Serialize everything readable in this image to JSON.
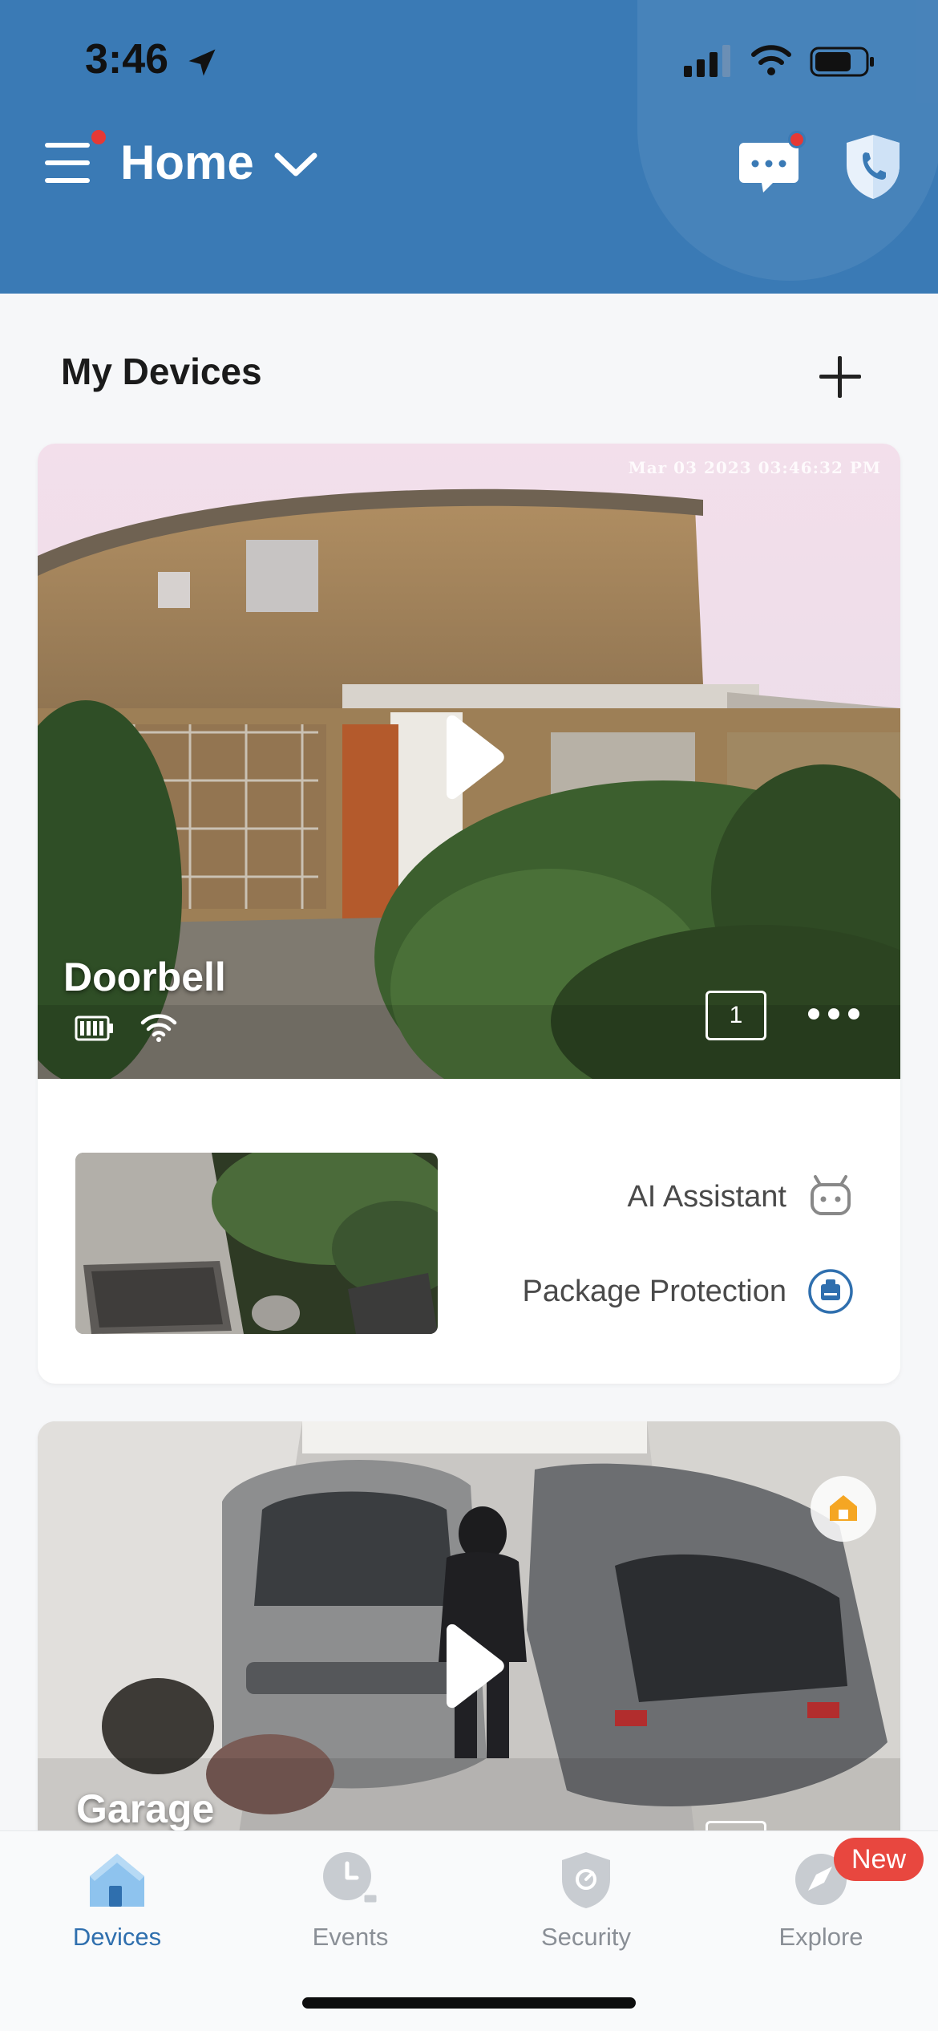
{
  "status_bar": {
    "time": "3:46"
  },
  "header": {
    "title": "Home"
  },
  "section": {
    "title": "My Devices"
  },
  "devices": [
    {
      "name": "Doorbell",
      "timestamp": "Mar 03 2023 03:46:32 PM",
      "event_count": "1",
      "features": [
        {
          "label": "AI Assistant",
          "icon": "robot-icon"
        },
        {
          "label": "Package Protection",
          "icon": "package-icon"
        }
      ]
    },
    {
      "name": "Garage"
    }
  ],
  "tabs": [
    {
      "label": "Devices",
      "icon": "house-icon",
      "active": true
    },
    {
      "label": "Events",
      "icon": "clock-icon"
    },
    {
      "label": "Security",
      "icon": "shield-check-icon"
    },
    {
      "label": "Explore",
      "icon": "compass-icon"
    }
  ],
  "explore_badge": "New",
  "colors": {
    "header": "#3a7ab5",
    "accent": "#2f6fae",
    "badge": "#e8473f"
  }
}
